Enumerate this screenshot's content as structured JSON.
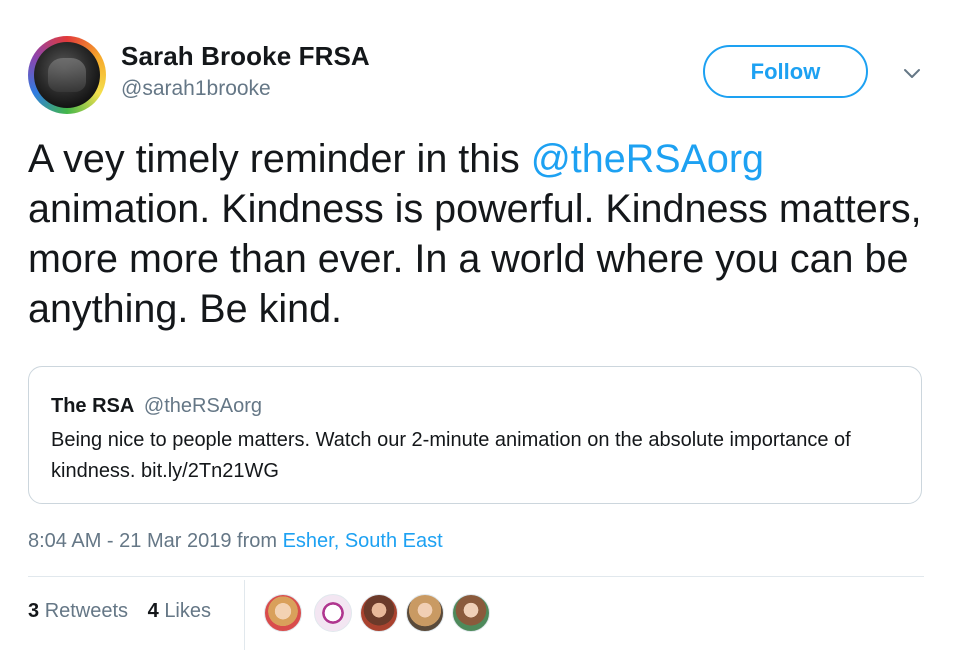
{
  "author": {
    "display_name": "Sarah Brooke FRSA",
    "handle": "@sarah1brooke"
  },
  "follow_button": {
    "label": "Follow"
  },
  "tweet": {
    "text_before": "A vey timely reminder in this ",
    "mention": "@theRSAorg",
    "text_after": " animation. Kindness is powerful. Kindness matters, more more than ever. In a world where you can be anything. Be kind."
  },
  "quoted_tweet": {
    "name": "The RSA",
    "handle": "@theRSAorg",
    "text": "Being nice to people matters. Watch our 2-minute animation on the absolute importance of kindness. bit.ly/2Tn21WG"
  },
  "meta": {
    "timestamp": "8:04 AM - 21 Mar 2019",
    "from_label": "from",
    "location": "Esher, South East"
  },
  "stats": {
    "retweets_count": "3",
    "retweets_label": "Retweets",
    "likes_count": "4",
    "likes_label": "Likes"
  },
  "icons": {
    "more": "chevron-down-icon"
  },
  "colors": {
    "accent": "#1da1f2",
    "text": "#14171a",
    "muted": "#657786",
    "border": "#ccd6dd"
  }
}
